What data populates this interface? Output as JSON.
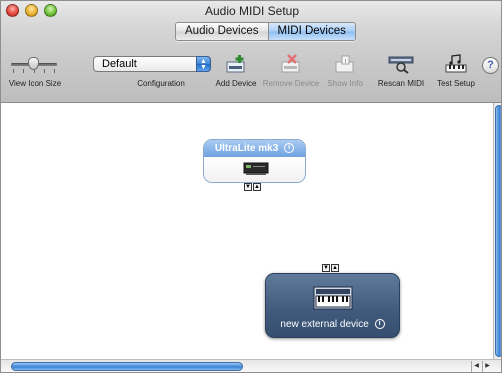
{
  "window": {
    "title": "Audio MIDI Setup"
  },
  "tabs": [
    {
      "label": "Audio Devices",
      "active": false
    },
    {
      "label": "MIDI Devices",
      "active": true
    }
  ],
  "toolbar": {
    "view_icon_size_label": "View Icon Size",
    "configuration": {
      "value": "Default",
      "label": "Configuration"
    },
    "add_device": "Add Device",
    "remove_device": "Remove Device",
    "show_info": "Show Info",
    "rescan_midi": "Rescan MIDI",
    "test_setup": "Test Setup",
    "help": "?"
  },
  "devices": [
    {
      "name": "UltraLite mk3",
      "info": "i"
    },
    {
      "name": "new external device",
      "info": "i"
    }
  ],
  "ports": {
    "in": "▼",
    "out": "▲"
  },
  "colors": {
    "accent": "#6fa2e0",
    "device_selected": "#3f5a7c"
  }
}
